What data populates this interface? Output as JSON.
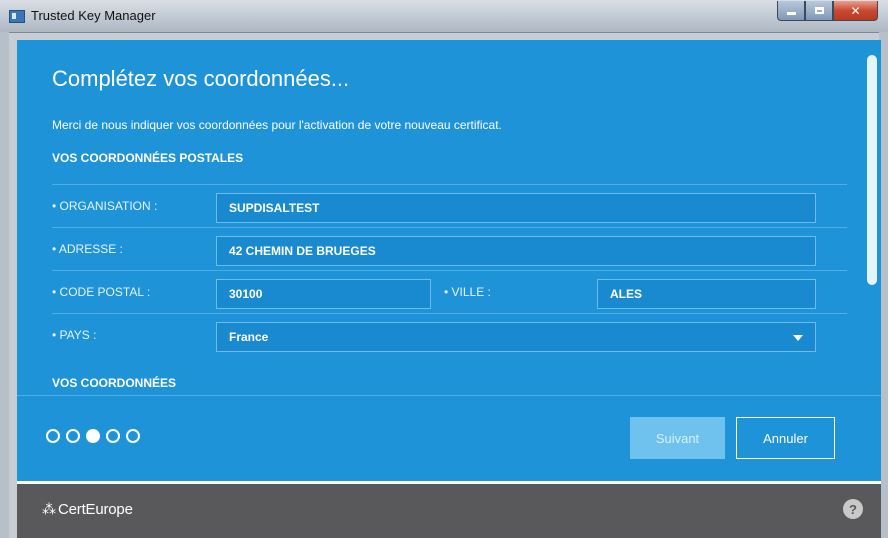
{
  "window": {
    "title": "Trusted Key Manager"
  },
  "main": {
    "heading": "Complétez vos coordonnées...",
    "intro": "Merci de nous indiquer vos coordonnées pour l'activation de votre nouveau certificat.",
    "section_postal": "VOS COORDONNÉES POSTALES",
    "section_contact": "VOS COORDONNÉES"
  },
  "form": {
    "organisation": {
      "label": "• ORGANISATION :",
      "value": "SUPDISALTEST"
    },
    "adresse": {
      "label": "• ADRESSE :",
      "value": "42 CHEMIN DE BRUEGES"
    },
    "code_postal": {
      "label": "• CODE POSTAL :",
      "value": "30100"
    },
    "ville": {
      "label": "• VILLE :",
      "value": "ALES"
    },
    "pays": {
      "label": "• PAYS :",
      "value": "France"
    }
  },
  "wizard": {
    "steps_total": 5,
    "current_step": 3
  },
  "buttons": {
    "next": "Suivant",
    "cancel": "Annuler"
  },
  "footer": {
    "logo_text": "CertEurope",
    "help_glyph": "?"
  },
  "colors": {
    "primary_blue": "#1f93d8",
    "footer_gray": "#59595b",
    "disabled_button": "#6fc2ee"
  }
}
